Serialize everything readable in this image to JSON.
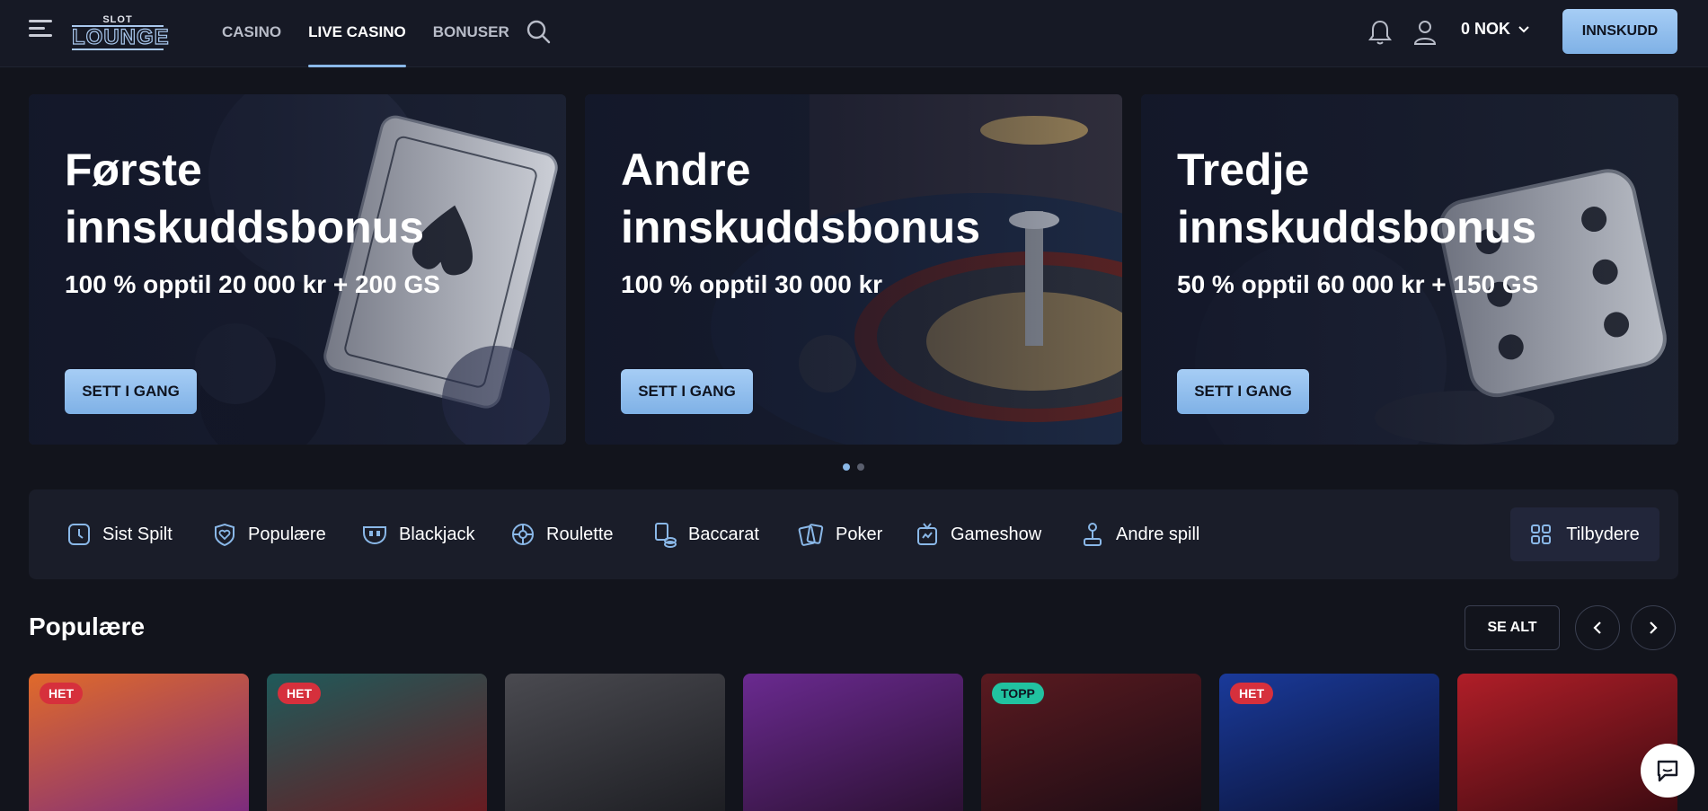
{
  "header": {
    "logo_top": "SLOT",
    "logo_main": "LOUNGE",
    "nav": [
      {
        "label": "CASINO",
        "active": false
      },
      {
        "label": "LIVE CASINO",
        "active": true
      },
      {
        "label": "BONUSER",
        "active": false
      }
    ],
    "balance": "0 NOK",
    "deposit_label": "INNSKUDD"
  },
  "banners": [
    {
      "title": "Første innskuddsbonus",
      "subtitle": "100 % opptil 20 000 kr + 200 GS",
      "cta": "SETT I GANG"
    },
    {
      "title": "Andre innskuddsbonus",
      "subtitle": "100 % opptil 30 000 kr",
      "cta": "SETT I GANG"
    },
    {
      "title": "Tredje innskuddsbonus",
      "subtitle": "50 % opptil 60 000 kr + 150 GS",
      "cta": "SETT I GANG"
    }
  ],
  "carousel": {
    "pages": 2,
    "active": 0
  },
  "categories": [
    {
      "label": "Sist Spilt",
      "icon": "clock-icon"
    },
    {
      "label": "Populære",
      "icon": "heart-shield-icon"
    },
    {
      "label": "Blackjack",
      "icon": "blackjack-icon"
    },
    {
      "label": "Roulette",
      "icon": "roulette-icon"
    },
    {
      "label": "Baccarat",
      "icon": "baccarat-icon"
    },
    {
      "label": "Poker",
      "icon": "poker-cards-icon"
    },
    {
      "label": "Gameshow",
      "icon": "tv-icon"
    },
    {
      "label": "Andre spill",
      "icon": "joystick-icon"
    }
  ],
  "providers_label": "Tilbydere",
  "section": {
    "title": "Populære",
    "see_all": "SE ALT"
  },
  "games": [
    {
      "badge": "HET",
      "bg": "#c64a2a"
    },
    {
      "badge": "HET",
      "bg": "#3a2330"
    },
    {
      "badge": "",
      "bg": "#2c2d33"
    },
    {
      "badge": "",
      "bg": "#5a2a6e"
    },
    {
      "badge": "TOPP",
      "bg": "#3a1620"
    },
    {
      "badge": "HET",
      "bg": "#132a6a"
    },
    {
      "badge": "",
      "bg": "#8a1820"
    }
  ],
  "colors": {
    "accent": "#8ab8e8",
    "hot": "#d6303c",
    "top": "#21c2a0",
    "bg": "#12141c"
  }
}
